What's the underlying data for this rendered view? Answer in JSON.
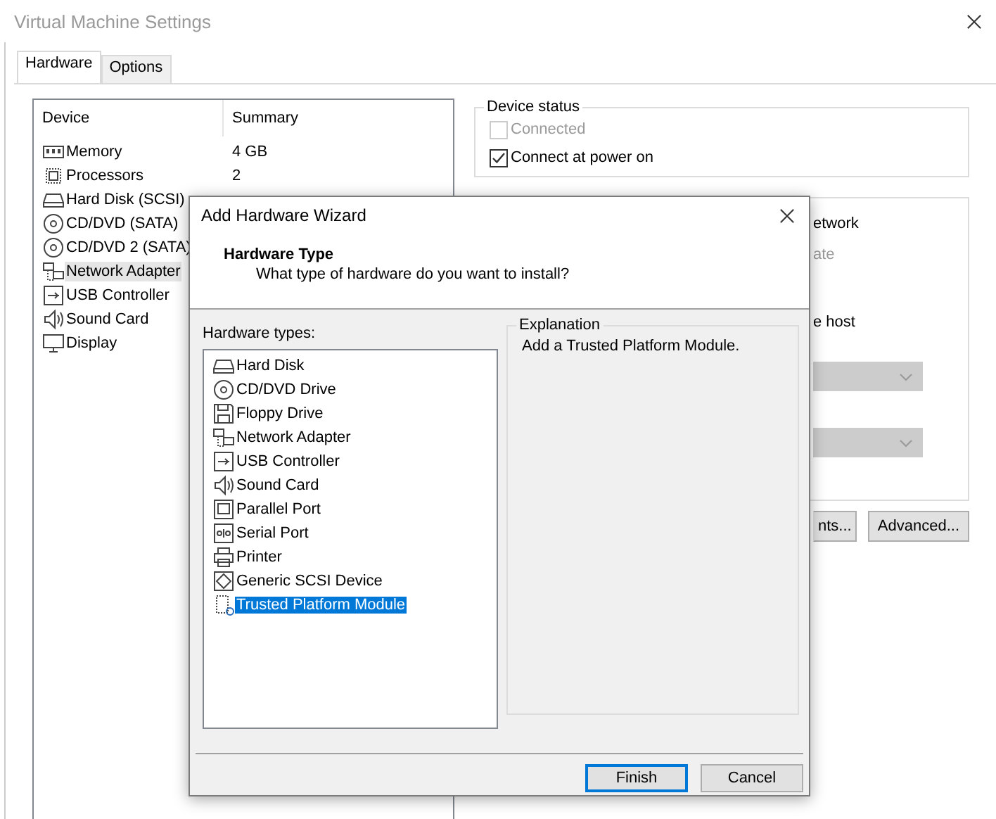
{
  "window": {
    "title": "Virtual Machine Settings"
  },
  "tabs": [
    {
      "label": "Hardware",
      "selected": true
    },
    {
      "label": "Options",
      "selected": false
    }
  ],
  "device_table": {
    "columns": [
      "Device",
      "Summary"
    ],
    "rows": [
      {
        "kind": "memory",
        "device": "Memory",
        "summary": "4 GB",
        "selected": false
      },
      {
        "kind": "cpu",
        "device": "Processors",
        "summary": "2",
        "selected": false
      },
      {
        "kind": "hdd",
        "device": "Hard Disk (SCSI)",
        "selected": false
      },
      {
        "kind": "cd",
        "device": "CD/DVD (SATA)",
        "selected": false
      },
      {
        "kind": "cd",
        "device": "CD/DVD 2 (SATA)",
        "selected": false
      },
      {
        "kind": "network",
        "device": "Network Adapter",
        "selected": true
      },
      {
        "kind": "usb",
        "device": "USB Controller",
        "selected": false
      },
      {
        "kind": "sound",
        "device": "Sound Card",
        "selected": false
      },
      {
        "kind": "display",
        "device": "Display",
        "selected": false
      }
    ]
  },
  "device_status": {
    "title": "Device status",
    "options": [
      {
        "label": "Connected",
        "checked": false,
        "disabled": true
      },
      {
        "label": "Connect at power on",
        "checked": true,
        "disabled": false
      }
    ]
  },
  "network_connection": {
    "items": [
      {
        "kind": "text",
        "text": "etwork",
        "disabled": false
      },
      {
        "kind": "text",
        "text": "ate",
        "disabled": true
      },
      {
        "kind": "text",
        "text": "e host",
        "disabled": false
      },
      {
        "kind": "dropdown",
        "disabled": true
      },
      {
        "kind": "dropdown",
        "disabled": true
      }
    ],
    "buttons": [
      "nts...",
      "Advanced..."
    ]
  },
  "dialog": {
    "title": "Add Hardware Wizard",
    "heading": "Hardware Type",
    "subheading": "What type of hardware do you want to install?",
    "list_label": "Hardware types:",
    "items": [
      {
        "kind": "hdd",
        "label": "Hard Disk",
        "selected": false
      },
      {
        "kind": "cd",
        "label": "CD/DVD Drive",
        "selected": false
      },
      {
        "kind": "floppy",
        "label": "Floppy Drive",
        "selected": false
      },
      {
        "kind": "network",
        "label": "Network Adapter",
        "selected": false
      },
      {
        "kind": "usb",
        "label": "USB Controller",
        "selected": false
      },
      {
        "kind": "sound",
        "label": "Sound Card",
        "selected": false
      },
      {
        "kind": "parallel",
        "label": "Parallel Port",
        "selected": false
      },
      {
        "kind": "serial",
        "label": "Serial Port",
        "selected": false
      },
      {
        "kind": "printer",
        "label": "Printer",
        "selected": false
      },
      {
        "kind": "scsi",
        "label": "Generic SCSI Device",
        "selected": false
      },
      {
        "kind": "tpm",
        "label": "Trusted Platform Module",
        "selected": true
      }
    ],
    "explanation": {
      "title": "Explanation",
      "text": "Add a Trusted Platform Module."
    },
    "buttons": [
      {
        "label": "Finish",
        "default": true
      },
      {
        "label": "Cancel",
        "default": false
      }
    ]
  }
}
